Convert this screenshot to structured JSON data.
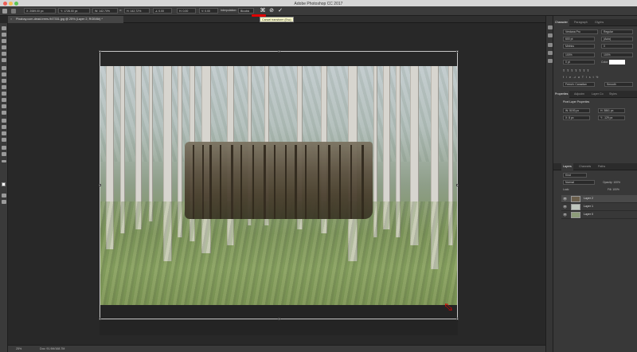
{
  "window": {
    "title": "Adobe Photoshop CC 2017"
  },
  "options_bar": {
    "x": "2089.00 px",
    "y": "1728.00 px",
    "w": "142.70%",
    "h": "142.72%",
    "angle": "0.00",
    "h_skew": "0.00",
    "v_skew": "0.00",
    "interpolation_label": "Interpolation:",
    "interpolation_value": "Bicubic",
    "cancel_tooltip": "Cancel transform (Esc)"
  },
  "document_tab": {
    "title": "Pixabay.com-dead-trees-947331.jpg @ 25% (Layer 2, RGB/8#) *",
    "close": "×"
  },
  "status_bar": {
    "zoom": "25%",
    "doc_size": "Doc: 91.9M/168.7M"
  },
  "character_panel": {
    "tabs": [
      "Character",
      "Paragraph",
      "Glyphs"
    ],
    "font_family": "Verdana Pro",
    "font_style": "Regular",
    "font_size": "600 pt",
    "leading": "(Auto)",
    "kerning": "Metrics",
    "tracking": "0",
    "vertical_scale": "100%",
    "horizontal_scale": "100%",
    "baseline_shift": "0 pt",
    "color_label": "Color:",
    "language": "French: Canadian",
    "antialias": "Smooth"
  },
  "properties_panel": {
    "tabs": [
      "Properties",
      "Adjustm",
      "Layer Co",
      "Styles"
    ],
    "header": "Pixel Layer Properties",
    "w": "W: 5193 px",
    "h": "H: 3861 px",
    "x": "X: 8 px",
    "y": "Y: -129 px"
  },
  "layers_panel": {
    "tabs": [
      "Layers",
      "Channels",
      "Paths"
    ],
    "kind": "Kind",
    "blend_mode": "Normal",
    "opacity": "Opacity: 100%",
    "lock_label": "Lock:",
    "fill": "Fill: 100%",
    "layers": [
      {
        "name": "Layer 2",
        "selected": true
      },
      {
        "name": "Layer 1",
        "selected": false
      },
      {
        "name": "Layer 0",
        "selected": false
      }
    ]
  },
  "colors": {
    "accent_red": "#e00000",
    "tooltip_bg": "#ffffcc",
    "panel_bg": "#383838"
  },
  "icons": {
    "tools": [
      "move-icon",
      "marquee-icon",
      "lasso-icon",
      "quick-select-icon",
      "crop-icon",
      "eyedropper-icon",
      "healing-icon",
      "brush-icon",
      "stamp-icon",
      "history-brush-icon",
      "eraser-icon",
      "gradient-icon",
      "blur-icon",
      "dodge-icon",
      "pen-icon",
      "type-icon",
      "path-select-icon",
      "shape-icon",
      "hand-icon",
      "zoom-icon"
    ]
  }
}
